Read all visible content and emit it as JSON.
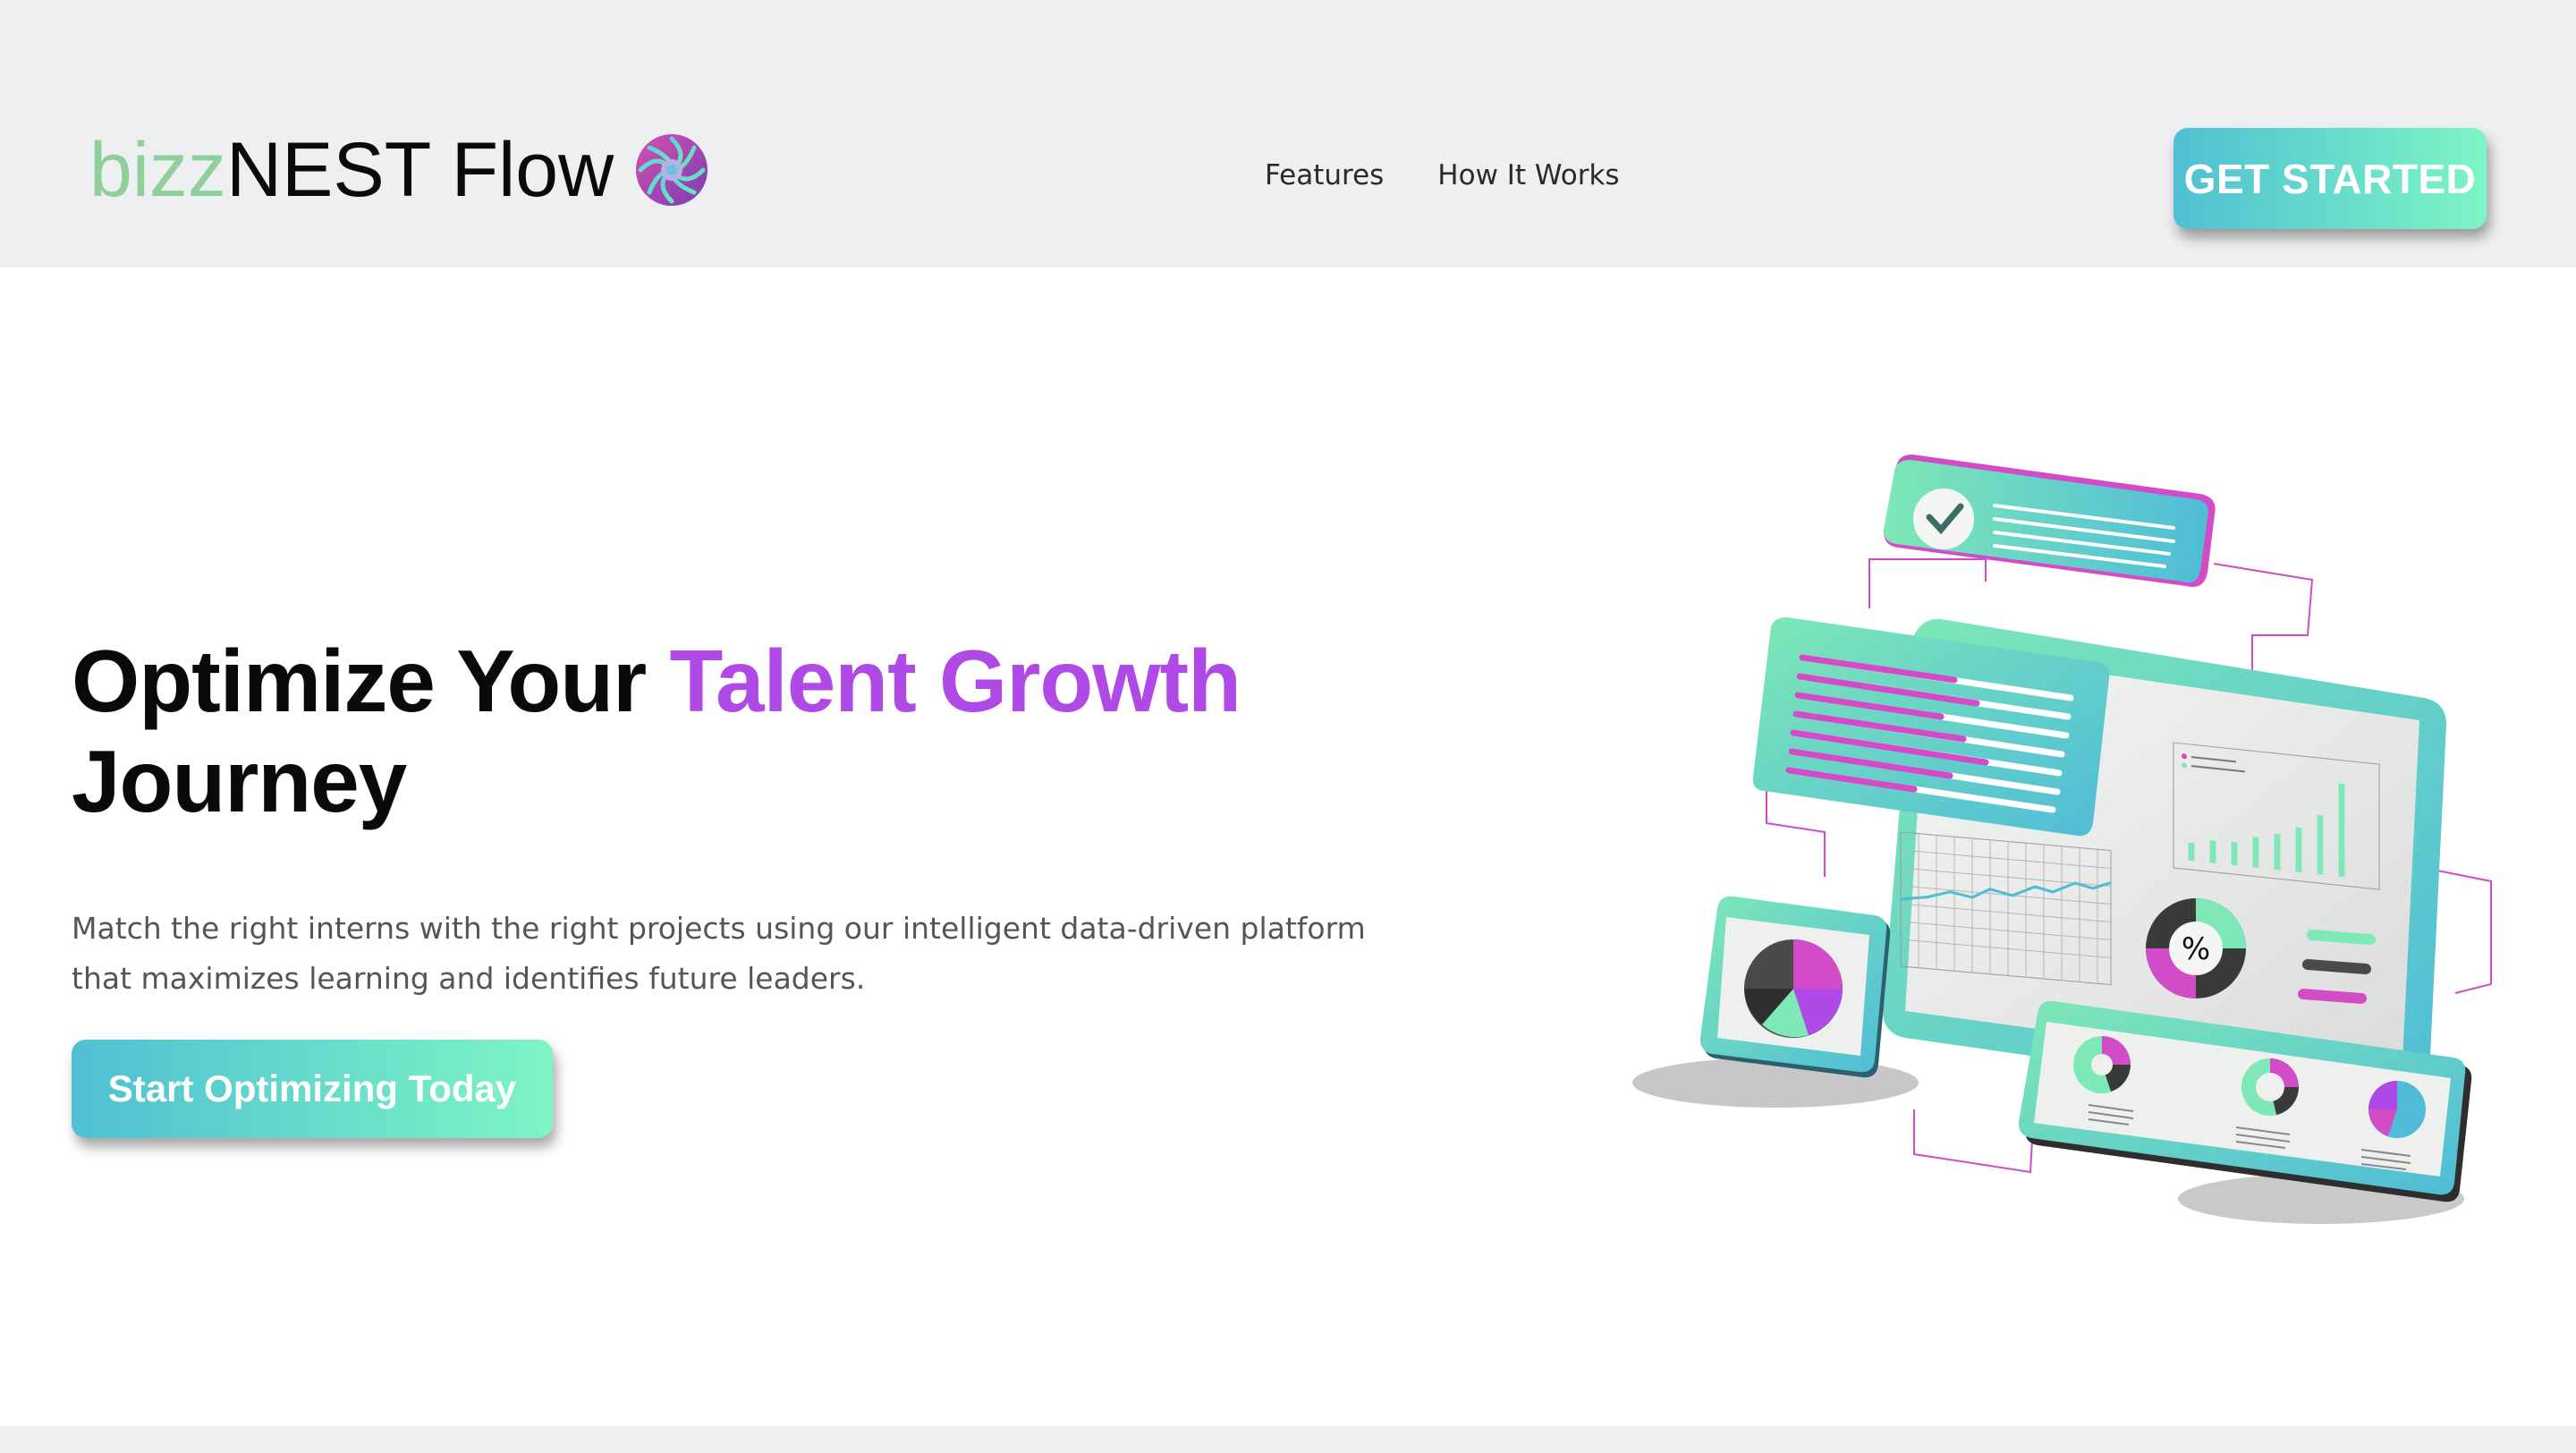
{
  "brand": {
    "part1": "bizz",
    "part2": "NEST Flow",
    "logo_icon": "swirl-logo-icon"
  },
  "nav": {
    "links": [
      "Features",
      "How It Works"
    ]
  },
  "header": {
    "cta_label": "GET STARTED"
  },
  "hero": {
    "title_part1": "Optimize Your ",
    "title_accent": "Talent Growth",
    "title_part2": "Journey",
    "subtitle_line1": "Match the right interns with the right projects using our intelligent data-driven platform",
    "subtitle_line2": "that maximizes learning and identifies future leaders.",
    "cta_label": "Start Optimizing Today"
  },
  "illustration": {
    "percent_symbol": "%",
    "icon": "dashboard-illustration"
  },
  "colors": {
    "accent": "#b04ae6",
    "gradient_start": "#4fc0d2",
    "gradient_end": "#7df5c4",
    "brand_green": "#8fcf9c",
    "nav_bg": "#eeeff1"
  }
}
